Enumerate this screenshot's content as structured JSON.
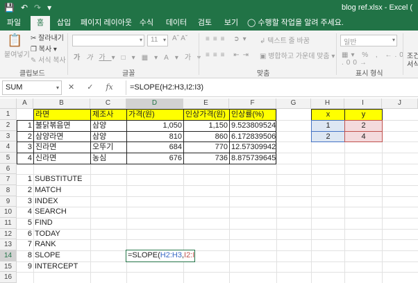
{
  "window": {
    "title": "blog ref.xlsx - Excel ("
  },
  "qat": {
    "save_icon": "save-icon",
    "undo_icon": "undo-icon",
    "redo_icon": "redo-icon",
    "customize_icon": "customize-icon"
  },
  "tabs": [
    "파일",
    "홈",
    "삽입",
    "페이지 레이아웃",
    "수식",
    "데이터",
    "검토",
    "보기"
  ],
  "active_tab": "홈",
  "tell_me": "수행할 작업을 알려 주세요.",
  "ribbon": {
    "clipboard": {
      "paste": "붙여넣기",
      "cut": "잘라내기",
      "copy": "복사",
      "format_painter": "서식 복사",
      "label": "클립보드"
    },
    "font": {
      "size": "11",
      "label": "글꼴"
    },
    "alignment": {
      "wrap": "텍스트 줄 바꿈",
      "merge": "병합하고 가운데 맞춤",
      "label": "맞춤"
    },
    "number": {
      "format": "일반",
      "label": "표시 형식"
    },
    "styles": {
      "cond": "조건부",
      "cond2": "서식"
    }
  },
  "formula_bar": {
    "name_box": "SUM",
    "cancel": "✕",
    "enter": "✓",
    "fx": "fx",
    "formula": "=SLOPE(H2:H3,I2:I3)"
  },
  "columns": [
    "A",
    "B",
    "C",
    "D",
    "E",
    "F",
    "G",
    "H",
    "I",
    "J"
  ],
  "rows": [
    "1",
    "2",
    "3",
    "4",
    "5",
    "6",
    "7",
    "8",
    "9",
    "10",
    "11",
    "12",
    "13",
    "14",
    "15",
    "16"
  ],
  "table": {
    "headers": [
      "라면",
      "제조사",
      "가격(원)",
      "인상가격(원)",
      "인상률(%)"
    ],
    "rows": [
      {
        "no": "1",
        "name": "불닭볶음면",
        "maker": "삼양",
        "price": "1,050",
        "new_price": "1,150",
        "rate": "9.523809524"
      },
      {
        "no": "2",
        "name": "삼양라면",
        "maker": "삼양",
        "price": "810",
        "new_price": "860",
        "rate": "6.172839506"
      },
      {
        "no": "3",
        "name": "진라면",
        "maker": "오뚜기",
        "price": "684",
        "new_price": "770",
        "rate": "12.57309942"
      },
      {
        "no": "4",
        "name": "신라면",
        "maker": "농심",
        "price": "676",
        "new_price": "736",
        "rate": "8.875739645"
      }
    ]
  },
  "xy": {
    "x_label": "x",
    "y_label": "y",
    "x": [
      "1",
      "2"
    ],
    "y": [
      "2",
      "4"
    ]
  },
  "functions": [
    {
      "no": "1",
      "name": "SUBSTITUTE"
    },
    {
      "no": "2",
      "name": "MATCH"
    },
    {
      "no": "3",
      "name": "INDEX"
    },
    {
      "no": "4",
      "name": "SEARCH"
    },
    {
      "no": "5",
      "name": "FIND"
    },
    {
      "no": "6",
      "name": "TODAY"
    },
    {
      "no": "7",
      "name": "RANK"
    },
    {
      "no": "8",
      "name": "SLOPE"
    },
    {
      "no": "9",
      "name": "INTERCEPT"
    }
  ],
  "editing_cell": {
    "prefix": "=SLOPE(",
    "ref1": "H2:H3",
    "comma": ",",
    "ref2": "I2:I3",
    "suffix": ")"
  }
}
